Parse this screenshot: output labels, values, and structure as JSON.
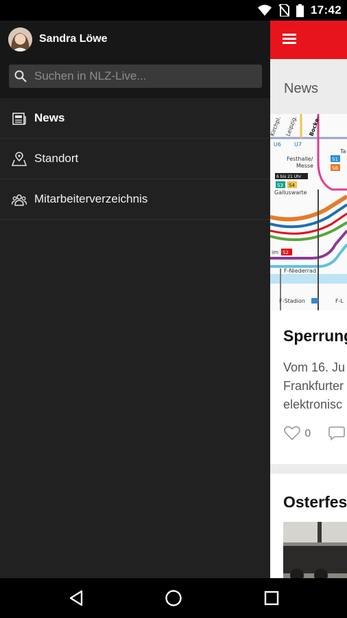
{
  "status_bar": {
    "time": "17:42",
    "icons": [
      "wifi-icon",
      "no-sim-icon",
      "battery-icon"
    ]
  },
  "drawer": {
    "user_name": "Sandra Löwe",
    "search_placeholder": "Suchen in NLZ-Live...",
    "items": [
      {
        "label": "News",
        "icon": "newspaper-icon",
        "active": true
      },
      {
        "label": "Standort",
        "icon": "location-map-icon",
        "active": false
      },
      {
        "label": "Mitarbeiterverzeichnis",
        "icon": "people-group-icon",
        "active": false
      }
    ]
  },
  "app": {
    "section_title": "News",
    "accent_color": "#e8141b",
    "cards": [
      {
        "title": "Sperrung",
        "text_lines": [
          "Vom 16. Ju",
          "Frankfurter",
          "elektronisc"
        ],
        "likes": "0",
        "map_labels": [
          "Kirchpl.",
          "Leipzig.",
          "Bocke-",
          "warte",
          "U6",
          "U7",
          "Ta",
          "Festhalle/",
          "Messe",
          "S1",
          "S6",
          "6 bis 21 Uhr",
          "S3",
          "S4",
          "Galluswarte",
          "S2",
          "F-Niederrad",
          "F-Stadion",
          "F-L"
        ]
      },
      {
        "title": "Osterfes"
      }
    ]
  },
  "nav_bar": {
    "buttons": [
      "back-icon",
      "home-icon",
      "recents-icon"
    ]
  },
  "colors": {
    "drawer_bg": "#212121",
    "drawer_header_bg": "#171717",
    "search_bg": "#3a3a3a"
  }
}
